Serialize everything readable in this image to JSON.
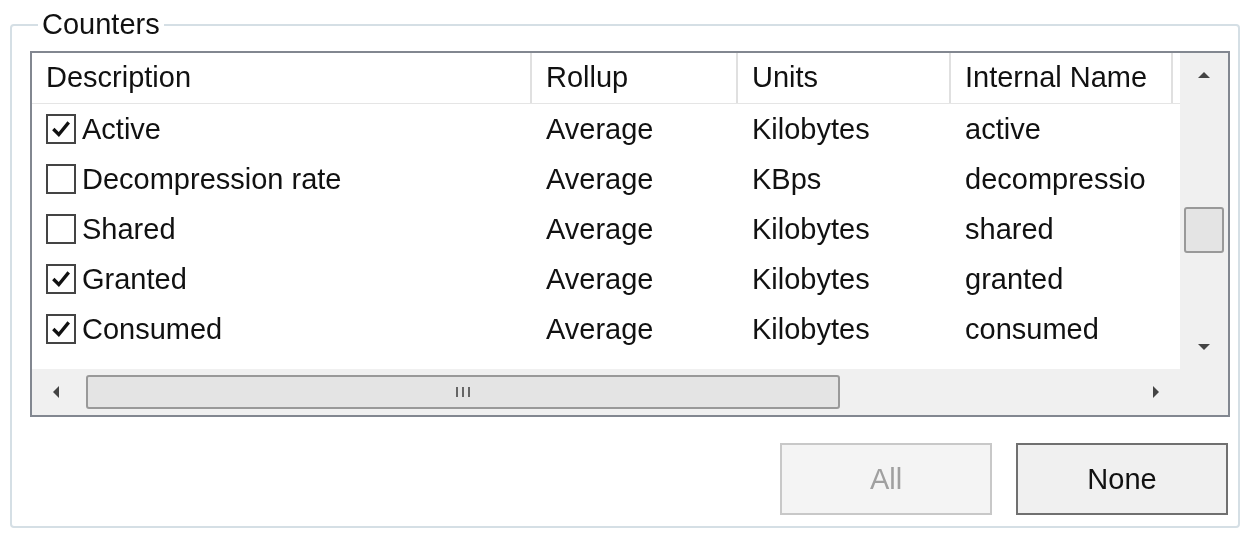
{
  "group": {
    "title": "Counters"
  },
  "table": {
    "columns": [
      "Description",
      "Rollup",
      "Units",
      "Internal Name"
    ],
    "rows": [
      {
        "checked": true,
        "cells": [
          "Active",
          "Average",
          "Kilobytes",
          "active"
        ]
      },
      {
        "checked": false,
        "cells": [
          "Decompression rate",
          "Average",
          "KBps",
          "decompressio"
        ]
      },
      {
        "checked": false,
        "cells": [
          "Shared",
          "Average",
          "Kilobytes",
          "shared"
        ]
      },
      {
        "checked": true,
        "cells": [
          "Granted",
          "Average",
          "Kilobytes",
          "granted"
        ]
      },
      {
        "checked": true,
        "cells": [
          "Consumed",
          "Average",
          "Kilobytes",
          "consumed"
        ]
      }
    ]
  },
  "buttons": [
    {
      "label": "All",
      "disabled": true
    },
    {
      "label": "None",
      "disabled": false
    }
  ]
}
